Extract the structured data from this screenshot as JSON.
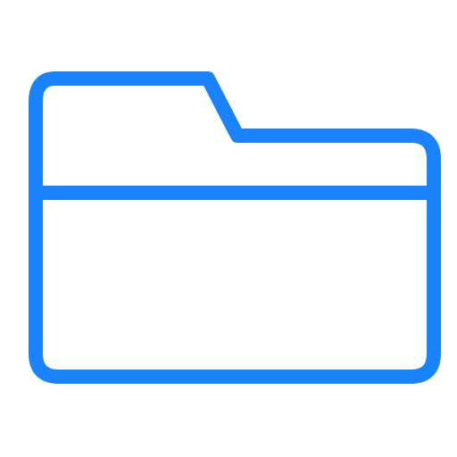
{
  "icon": {
    "name": "folder-icon",
    "color": "#1a82fb",
    "background": "#ffffff",
    "style": "outline"
  }
}
